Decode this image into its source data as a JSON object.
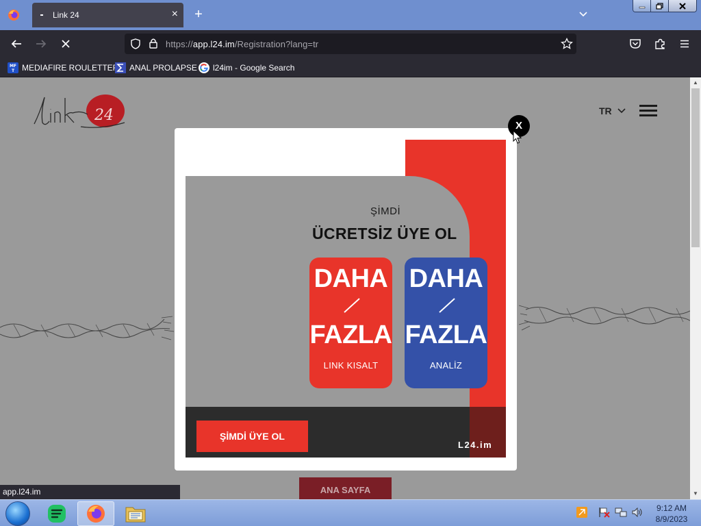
{
  "browser": {
    "tab_title": "Link 24",
    "url_prefix": "https://",
    "url_host": "app.l24.im",
    "url_path": "/Registration?lang=tr",
    "status_url": "app.l24.im"
  },
  "bookmarks": [
    {
      "label": "MEDIAFIRE ROULETTER",
      "icon": "mediafire-icon"
    },
    {
      "label": "ANAL PROLAPSE",
      "icon": "sigma-icon"
    },
    {
      "label": "l24im - Google Search",
      "icon": "google-icon"
    }
  ],
  "page": {
    "language": "TR",
    "home_button": "ANA SAYFA"
  },
  "modal": {
    "close_label": "X",
    "promo": {
      "kicker": "ŞİMDİ",
      "headline": "ÜCRETSİZ ÜYE OL",
      "cards": [
        {
          "line1": "DAHA",
          "line2": "FAZLA",
          "sub": "LINK KISALT",
          "color": "#e8342a"
        },
        {
          "line1": "DAHA",
          "line2": "FAZLA",
          "sub": "ANALİZ",
          "color": "#3451a8"
        }
      ],
      "cta": "ŞİMDİ ÜYE OL",
      "brand": "L24.im"
    }
  },
  "taskbar": {
    "time": "9:12 AM",
    "date": "8/9/2023"
  },
  "colors": {
    "accent_red": "#e8342a",
    "accent_blue": "#3451a8",
    "browser_dark": "#2b2a33"
  }
}
